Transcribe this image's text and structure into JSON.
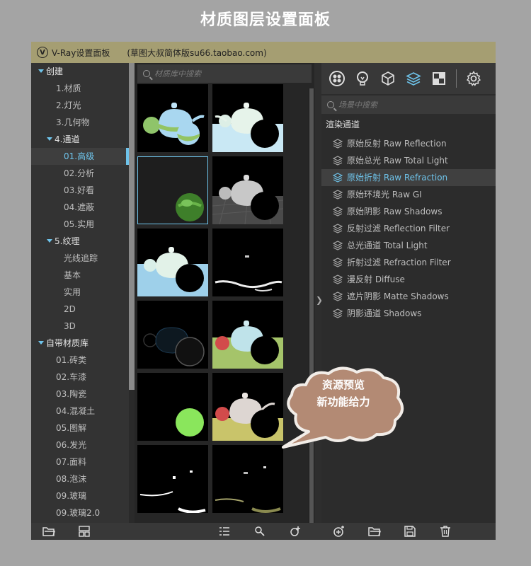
{
  "page_title": "材质图层设置面板",
  "window": {
    "app_name": "V-Ray设置面板",
    "subtitle": "(草图大叔简体版su66.taobao.com)",
    "logo_letter": "V"
  },
  "tree": {
    "items": [
      {
        "label": "创建",
        "level": 0,
        "expanded": true
      },
      {
        "label": "1.材质",
        "level": 1
      },
      {
        "label": "2.灯光",
        "level": 1
      },
      {
        "label": "3.几何物",
        "level": 1
      },
      {
        "label": "4.通道",
        "level": 1,
        "expanded": true
      },
      {
        "label": "01.高级",
        "level": 2,
        "selected": true
      },
      {
        "label": "02.分析",
        "level": 2
      },
      {
        "label": "03.好看",
        "level": 2
      },
      {
        "label": "04.遮蔽",
        "level": 2
      },
      {
        "label": "05.实用",
        "level": 2
      },
      {
        "label": "5.纹理",
        "level": 1,
        "expanded": true
      },
      {
        "label": "光线追踪",
        "level": 2
      },
      {
        "label": "基本",
        "level": 2
      },
      {
        "label": "实用",
        "level": 2
      },
      {
        "label": "2D",
        "level": 2
      },
      {
        "label": "3D",
        "level": 2
      },
      {
        "label": "自带材质库",
        "level": 0,
        "expanded": true
      },
      {
        "label": "01.砖类",
        "level": 1
      },
      {
        "label": "02.车漆",
        "level": 1
      },
      {
        "label": "03.陶瓷",
        "level": 1
      },
      {
        "label": "04.混凝土",
        "level": 1
      },
      {
        "label": "05.图解",
        "level": 1
      },
      {
        "label": "06.发光",
        "level": 1
      },
      {
        "label": "07.面料",
        "level": 1
      },
      {
        "label": "08.泡沫",
        "level": 1
      },
      {
        "label": "09.玻璃",
        "level": 1
      },
      {
        "label": "09.玻璃2.0",
        "level": 1
      }
    ]
  },
  "library_search": {
    "placeholder": "材质库中搜索"
  },
  "channel_search": {
    "placeholder": "场景中搜索"
  },
  "channels": {
    "title": "渲染通道",
    "items": [
      {
        "label": "原始反射 Raw Reflection"
      },
      {
        "label": "原始总光 Raw Total Light"
      },
      {
        "label": "原始折射 Raw Refraction",
        "selected": true
      },
      {
        "label": "原始环境光 Raw GI"
      },
      {
        "label": "原始阴影 Raw Shadows"
      },
      {
        "label": "反射过滤 Reflection Filter"
      },
      {
        "label": "总光通道 Total Light"
      },
      {
        "label": "折射过滤 Refraction Filter"
      },
      {
        "label": "漫反射 Diffuse"
      },
      {
        "label": "遮片阴影 Matte Shadows"
      },
      {
        "label": "阴影通道 Shadows"
      }
    ]
  },
  "toolbar_icons": [
    "materials-icon",
    "lights-icon",
    "geometry-icon",
    "render-channels-icon",
    "textures-icon",
    "settings-icon"
  ],
  "bottom_icons": [
    "open-folder-icon",
    "layout-icon",
    "list-view-icon",
    "search-add-icon",
    "add-to-scene-icon",
    "add-layer-icon",
    "open-file-icon",
    "save-icon",
    "delete-icon"
  ],
  "callout": {
    "line1": "资源预览",
    "line2": "新功能给力"
  },
  "colors": {
    "accent": "#6ec3ea",
    "titlebar": "#a59e72",
    "callout": "#b38a74"
  }
}
